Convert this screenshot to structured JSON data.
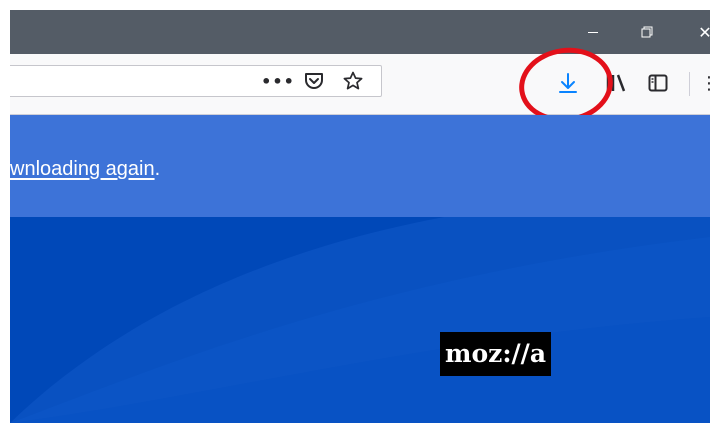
{
  "window": {
    "minimize_icon": "minimize-icon",
    "restore_icon": "restore-icon",
    "close_icon": "close-icon"
  },
  "toolbar": {
    "page_actions_label": "•••",
    "icons": [
      "page-actions-icon",
      "pocket-icon",
      "bookmark-star-icon",
      "downloads-arrow-icon",
      "library-icon",
      "sidebar-icon",
      "overflow-menu-icon"
    ],
    "accent_color": "#0a84ff"
  },
  "annotation": {
    "highlight_color": "#e3101a"
  },
  "page": {
    "notice_link": "wnloading again",
    "notice_suffix": ".",
    "logo_text": "moz://a",
    "notice_bg": "#3d73d8",
    "hero_bg": "#0048b8"
  }
}
